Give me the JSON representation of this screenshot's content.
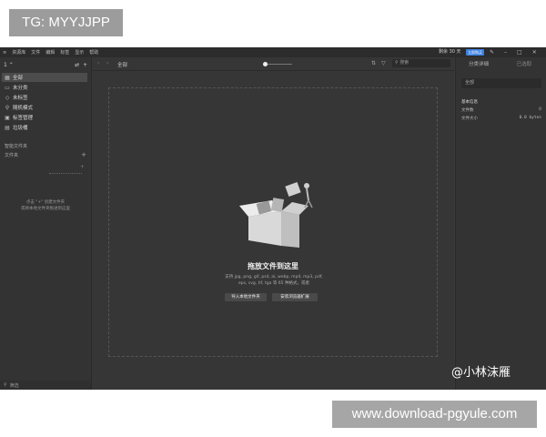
{
  "overlays": {
    "tg_label": "TG: MYYJJPP",
    "download_label": "www.download-pgyule.com",
    "watermark": "@小林沫雁"
  },
  "titlebar": {
    "menu": [
      "资源库",
      "文件",
      "编辑",
      "标签",
      "显示",
      "帮助"
    ],
    "trial_text": "剩余 30 天",
    "buy_label": "立即购买"
  },
  "sidebar": {
    "library_label": "1",
    "items": [
      {
        "label": "全部",
        "icon": "grid-icon"
      },
      {
        "label": "未分类",
        "icon": "folder-icon"
      },
      {
        "label": "未标签",
        "icon": "tag-icon"
      },
      {
        "label": "随机模式",
        "icon": "shuffle-icon"
      },
      {
        "label": "标签管理",
        "icon": "tag-manage-icon"
      },
      {
        "label": "垃圾桶",
        "icon": "trash-icon"
      }
    ],
    "smart_folder_label": "智能文件夹",
    "folder_label": "文件夹",
    "hint_line1": "点击 \"+\" 创建文件夹",
    "hint_line2": "或将本地文件夹拖进到这里",
    "search_placeholder": "筛选"
  },
  "toolbar": {
    "breadcrumb": "全部",
    "search_placeholder": "搜索"
  },
  "dropzone": {
    "title": "拖放文件到这里",
    "desc_line1": "支持 jpg, png, gif, psd, ai, webp, mp4, mp3, pdf,",
    "desc_line2": "eps, svg, tif, tga 等 65 种格式，或者",
    "btn_import": "导入本地文件夹",
    "btn_extension": "安装浏览器扩展"
  },
  "rightpanel": {
    "tab_details": "分类详细",
    "tab_selected": "已选取",
    "search_value": "全部",
    "info_title": "基本信息",
    "file_count_label": "文件数",
    "file_count_value": "0",
    "file_size_label": "文件大小",
    "file_size_value": "0.0 bytes"
  },
  "colors": {
    "accent": "#3b7fe0",
    "background": "#383838"
  }
}
